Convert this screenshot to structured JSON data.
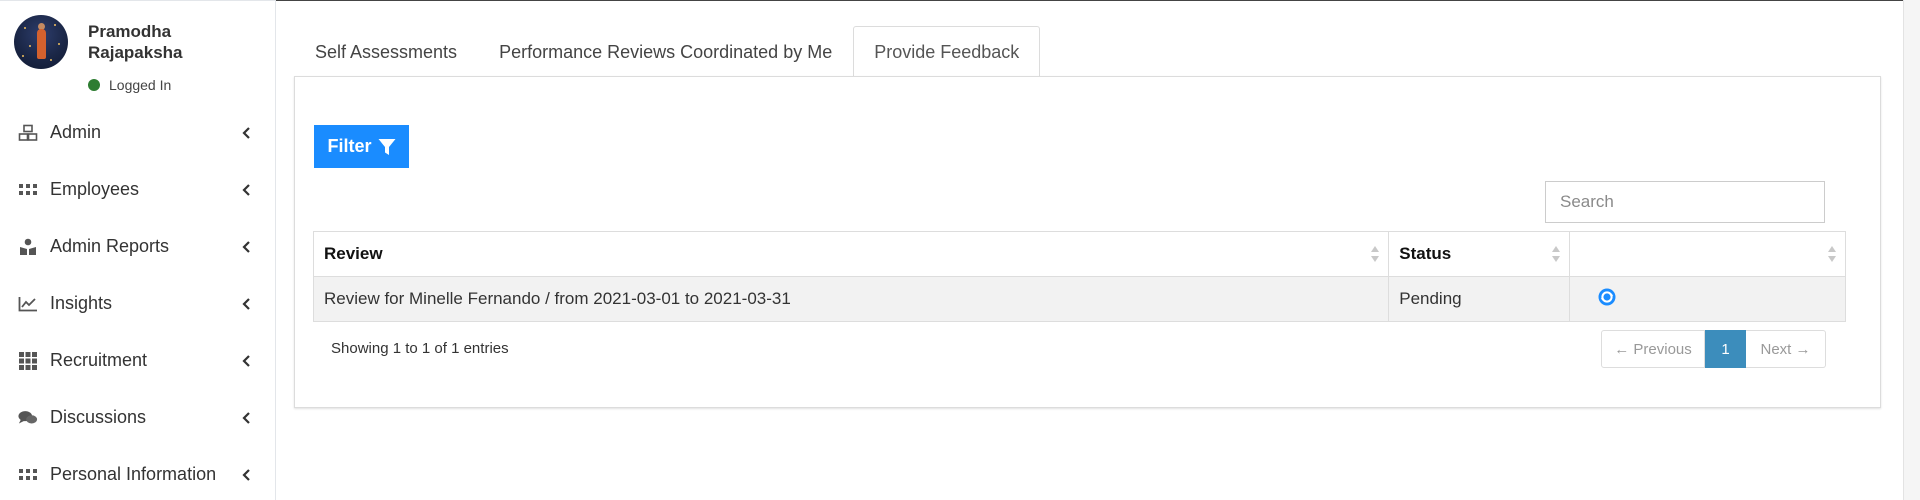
{
  "user": {
    "name": "Pramodha Rajapaksha",
    "status": "Logged In"
  },
  "sidebar": {
    "items": [
      {
        "label": "Admin",
        "icon": "cubes-icon"
      },
      {
        "label": "Employees",
        "icon": "th-icon"
      },
      {
        "label": "Admin Reports",
        "icon": "user-report-icon"
      },
      {
        "label": "Insights",
        "icon": "line-chart-icon"
      },
      {
        "label": "Recruitment",
        "icon": "grid-icon"
      },
      {
        "label": "Discussions",
        "icon": "comments-icon"
      },
      {
        "label": "Personal Information",
        "icon": "th-icon"
      }
    ]
  },
  "tabs": [
    {
      "label": "Self Assessments",
      "active": false
    },
    {
      "label": "Performance Reviews Coordinated by Me",
      "active": false
    },
    {
      "label": "Provide Feedback",
      "active": true
    }
  ],
  "toolbar": {
    "filter_label": "Filter"
  },
  "search": {
    "placeholder": "Search"
  },
  "table": {
    "headers": [
      "Review",
      "Status",
      ""
    ],
    "rows": [
      {
        "review": "Review for Minelle Fernando / from 2021-03-01 to 2021-03-31",
        "status": "Pending",
        "action_icon": "gear-refresh-icon"
      }
    ]
  },
  "footer": {
    "info": "Showing 1 to 1 of 1 entries",
    "prev_label": "← Previous",
    "current_page": "1",
    "next_label": "Next →"
  },
  "colors": {
    "primary": "#1a8cff",
    "pagination_active": "#3c8dbc",
    "status_online": "#2e7d32"
  }
}
